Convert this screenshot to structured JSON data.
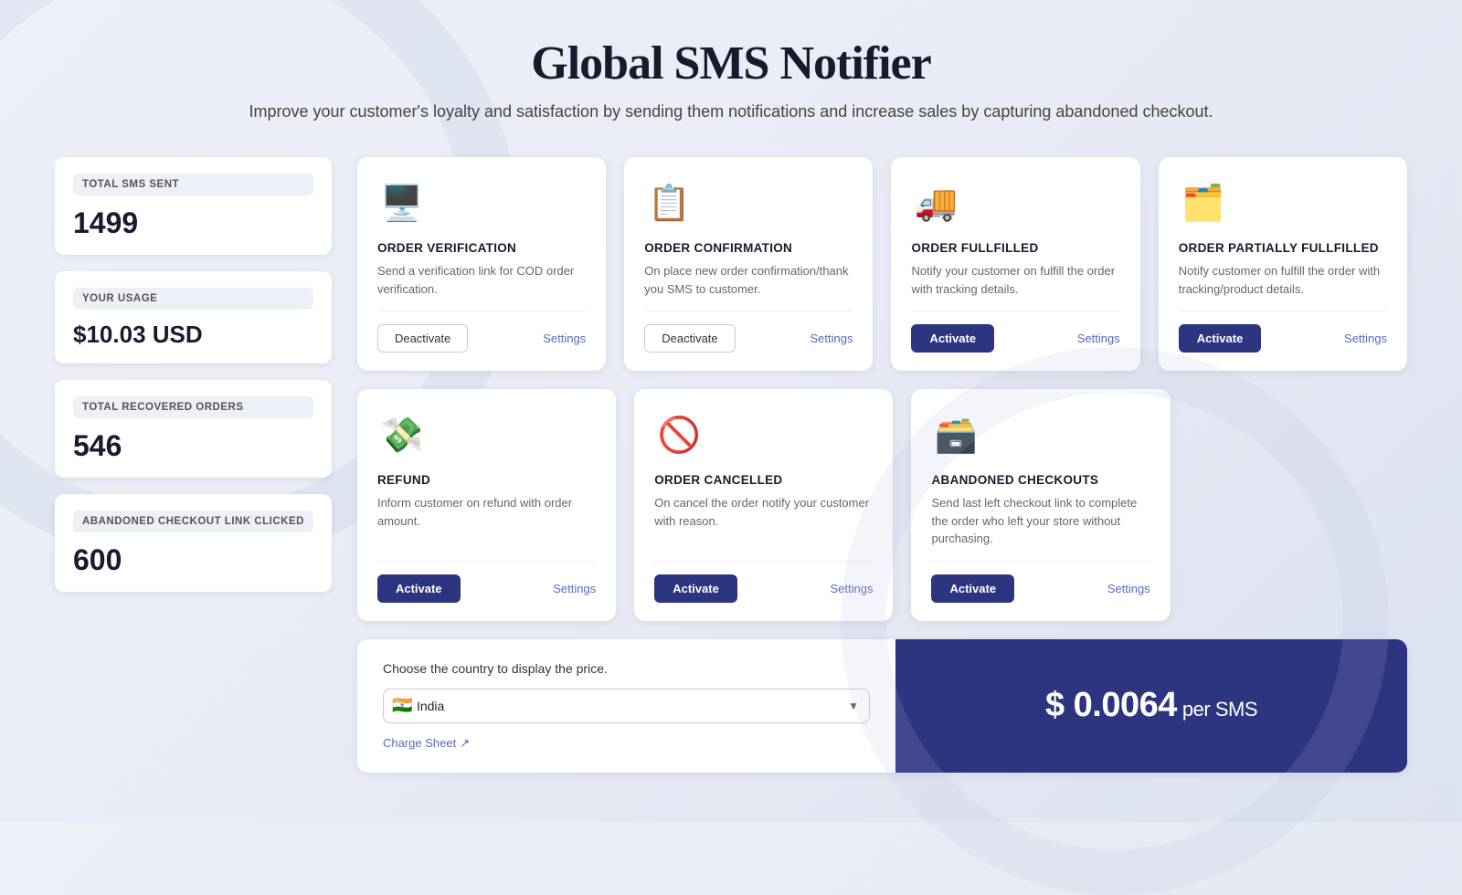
{
  "header": {
    "title": "Global SMS Notifier",
    "subtitle": "Improve your customer's loyalty and satisfaction by sending them notifications and increase sales by capturing abandoned checkout."
  },
  "sidebar": {
    "stats": [
      {
        "id": "total-sms-sent",
        "label": "TOTAL SMS SENT",
        "value": "1499"
      },
      {
        "id": "your-usage",
        "label": "YOUR USAGE",
        "value": "$10.03 USD"
      },
      {
        "id": "total-recovered-orders",
        "label": "TOTAL RECOVERED ORDERS",
        "value": "546"
      },
      {
        "id": "abandoned-checkout-link-clicked",
        "label": "ABANDONED CHECKOUT LINK CLICKED",
        "value": "600"
      }
    ]
  },
  "cards_row1": [
    {
      "id": "order-verification",
      "icon": "🖥️",
      "title": "ORDER VERIFICATION",
      "description": "Send a verification link for COD order verification.",
      "button": "Deactivate",
      "button_type": "deactivate",
      "settings_label": "Settings"
    },
    {
      "id": "order-confirmation",
      "icon": "📋",
      "title": "ORDER CONFIRMATION",
      "description": "On place new order confirmation/thank you SMS to customer.",
      "button": "Deactivate",
      "button_type": "deactivate",
      "settings_label": "Settings"
    },
    {
      "id": "order-fulfilled",
      "icon": "🚚",
      "title": "ORDER FULLFILLED",
      "description": "Notify your customer on fulfill the order with tracking details.",
      "button": "Activate",
      "button_type": "activate",
      "settings_label": "Settings"
    },
    {
      "id": "order-partially-fulfilled",
      "icon": "🗂️",
      "title": "ORDER PARTIALLY FULLFILLED",
      "description": "Notify customer on fulfill the order with tracking/product details.",
      "button": "Activate",
      "button_type": "activate",
      "settings_label": "Settings"
    }
  ],
  "cards_row2": [
    {
      "id": "refund",
      "icon": "💸",
      "title": "REFUND",
      "description": "Inform customer on refund with order amount.",
      "button": "Activate",
      "button_type": "activate",
      "settings_label": "Settings"
    },
    {
      "id": "order-cancelled",
      "icon": "🚫",
      "title": "ORDER CANCELLED",
      "description": "On cancel the order notify your customer with reason.",
      "button": "Activate",
      "button_type": "activate",
      "settings_label": "Settings"
    },
    {
      "id": "abandoned-checkouts",
      "icon": "🗃️",
      "title": "ABANDONED CHECKOUTS",
      "description": "Send last left checkout link to complete the order who left your store without purchasing.",
      "button": "Activate",
      "button_type": "activate",
      "settings_label": "Settings"
    }
  ],
  "bottom": {
    "country_label": "Choose the country to display the price.",
    "country_value": "India",
    "country_flag": "🇮🇳",
    "charge_sheet_label": "Charge Sheet",
    "price": "$ 0.0064",
    "per_sms": "per SMS"
  }
}
